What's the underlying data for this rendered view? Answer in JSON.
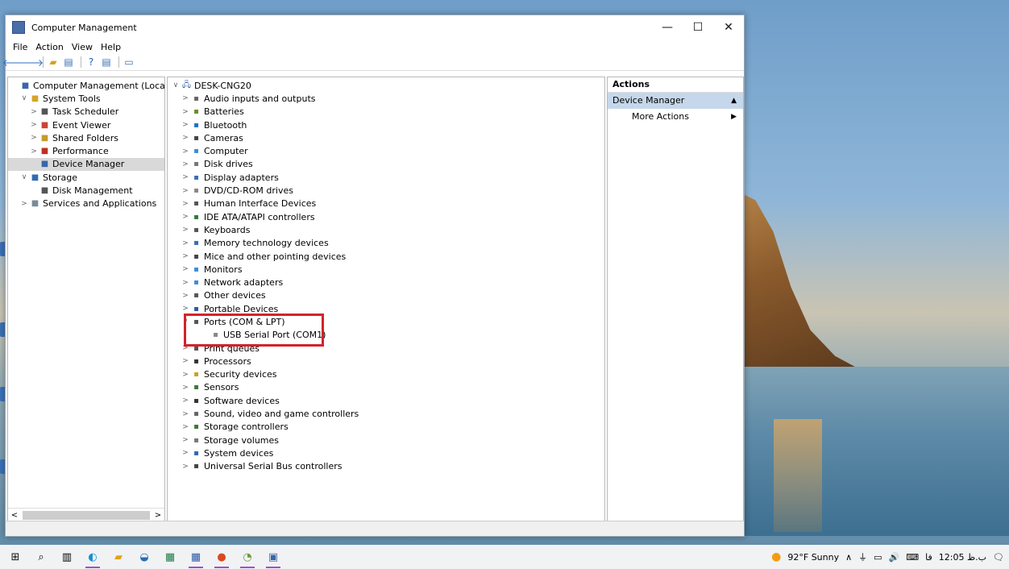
{
  "window": {
    "title": "Computer Management",
    "minimize": "—",
    "maximize": "☐",
    "close": "✕"
  },
  "menu": [
    "File",
    "Action",
    "View",
    "Help"
  ],
  "left_tree": [
    {
      "label": "Computer Management (Local",
      "level": 0,
      "expander": ""
    },
    {
      "label": "System Tools",
      "level": 1,
      "expander": "∨"
    },
    {
      "label": "Task Scheduler",
      "level": 2,
      "expander": ">"
    },
    {
      "label": "Event Viewer",
      "level": 2,
      "expander": ">"
    },
    {
      "label": "Shared Folders",
      "level": 2,
      "expander": ">"
    },
    {
      "label": "Performance",
      "level": 2,
      "expander": ">"
    },
    {
      "label": "Device Manager",
      "level": 2,
      "expander": ""
    },
    {
      "label": "Storage",
      "level": 1,
      "expander": "∨"
    },
    {
      "label": "Disk Management",
      "level": 2,
      "expander": ""
    },
    {
      "label": "Services and Applications",
      "level": 1,
      "expander": ">"
    }
  ],
  "device_tree": {
    "root": "DESK-CNG20",
    "items": [
      "Audio inputs and outputs",
      "Batteries",
      "Bluetooth",
      "Cameras",
      "Computer",
      "Disk drives",
      "Display adapters",
      "DVD/CD-ROM drives",
      "Human Interface Devices",
      "IDE ATA/ATAPI controllers",
      "Keyboards",
      "Memory technology devices",
      "Mice and other pointing devices",
      "Monitors",
      "Network adapters",
      "Other devices",
      "Portable Devices",
      "Ports (COM & LPT)",
      "USB Serial Port (COM1)",
      "Print queues",
      "Processors",
      "Security devices",
      "Sensors",
      "Software devices",
      "Sound, video and game controllers",
      "Storage controllers",
      "Storage volumes",
      "System devices",
      "Universal Serial Bus controllers"
    ]
  },
  "actions": {
    "header": "Actions",
    "section": "Device Manager",
    "item": "More Actions"
  },
  "taskbar": {
    "weather": "92°F  Sunny",
    "time": "12:05 ب.ظ",
    "lang": "فا"
  },
  "colors": {
    "highlight_box": "#d3232b",
    "accent": "#9f4fc9"
  }
}
